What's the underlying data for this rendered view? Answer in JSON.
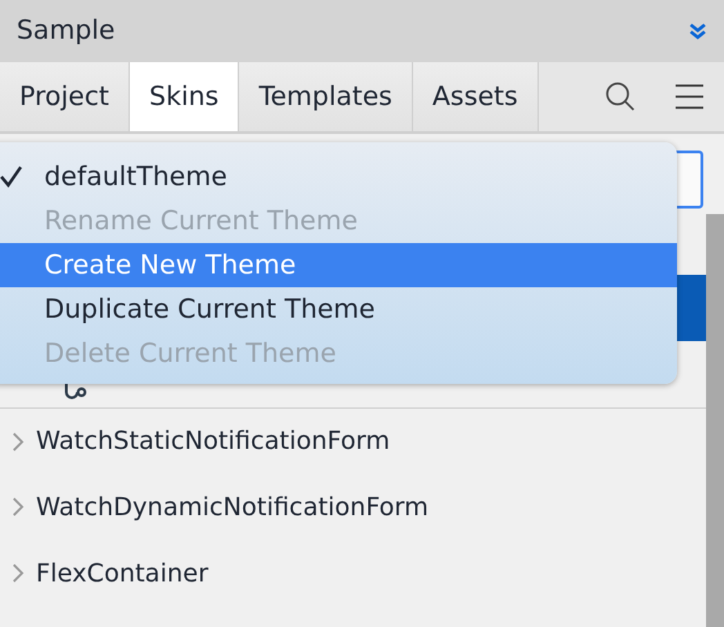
{
  "panel": {
    "title": "Sample"
  },
  "tabs": [
    {
      "label": "Project",
      "selected": false
    },
    {
      "label": "Skins",
      "selected": true
    },
    {
      "label": "Templates",
      "selected": false
    },
    {
      "label": "Assets",
      "selected": false
    }
  ],
  "tree": {
    "items": [
      {
        "kind": "form"
      },
      {
        "label": "WatchStaticNotificationForm",
        "kind": "group"
      },
      {
        "label": "WatchDynamicNotificationForm",
        "kind": "group"
      },
      {
        "label": "FlexContainer",
        "kind": "group"
      }
    ]
  },
  "theme_menu": {
    "items": [
      {
        "label": "defaultTheme",
        "checked": true,
        "disabled": false,
        "selected": false
      },
      {
        "label": "Rename Current Theme",
        "checked": false,
        "disabled": true,
        "selected": false
      },
      {
        "label": "Create New Theme",
        "checked": false,
        "disabled": false,
        "selected": true
      },
      {
        "label": "Duplicate Current Theme",
        "checked": false,
        "disabled": false,
        "selected": false
      },
      {
        "label": "Delete Current Theme",
        "checked": false,
        "disabled": true,
        "selected": false
      }
    ]
  }
}
